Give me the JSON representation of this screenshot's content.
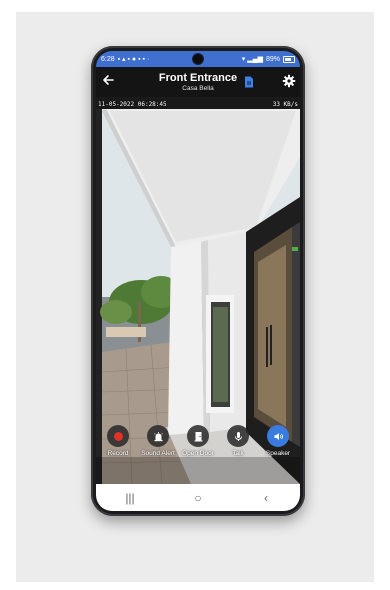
{
  "status_bar": {
    "time": "6:28",
    "battery": "89%"
  },
  "app_bar": {
    "back_icon": "arrow-left-icon",
    "title": "Front Entrance",
    "subtitle": "Casa Bella",
    "doc_icon": "document-icon",
    "settings_icon": "gear-icon"
  },
  "video": {
    "timestamp": "11-05-2022 06:28:45",
    "bitrate": "33 KB/s"
  },
  "controls": [
    {
      "label": "Record",
      "icon": "record-icon",
      "active": false
    },
    {
      "label": "Sound Alert",
      "icon": "alarm-icon",
      "active": false
    },
    {
      "label": "Open Door",
      "icon": "door-icon",
      "active": false
    },
    {
      "label": "Talk",
      "icon": "microphone-icon",
      "active": false
    },
    {
      "label": "Speaker",
      "icon": "speaker-icon",
      "active": true
    }
  ],
  "nav_bar": {
    "recents": "|||",
    "home": "○",
    "back": "‹"
  },
  "colors": {
    "status_bar": "#3f6fcf",
    "app_bar": "#141414",
    "accent": "#3a7be0",
    "record": "#e0312a"
  }
}
